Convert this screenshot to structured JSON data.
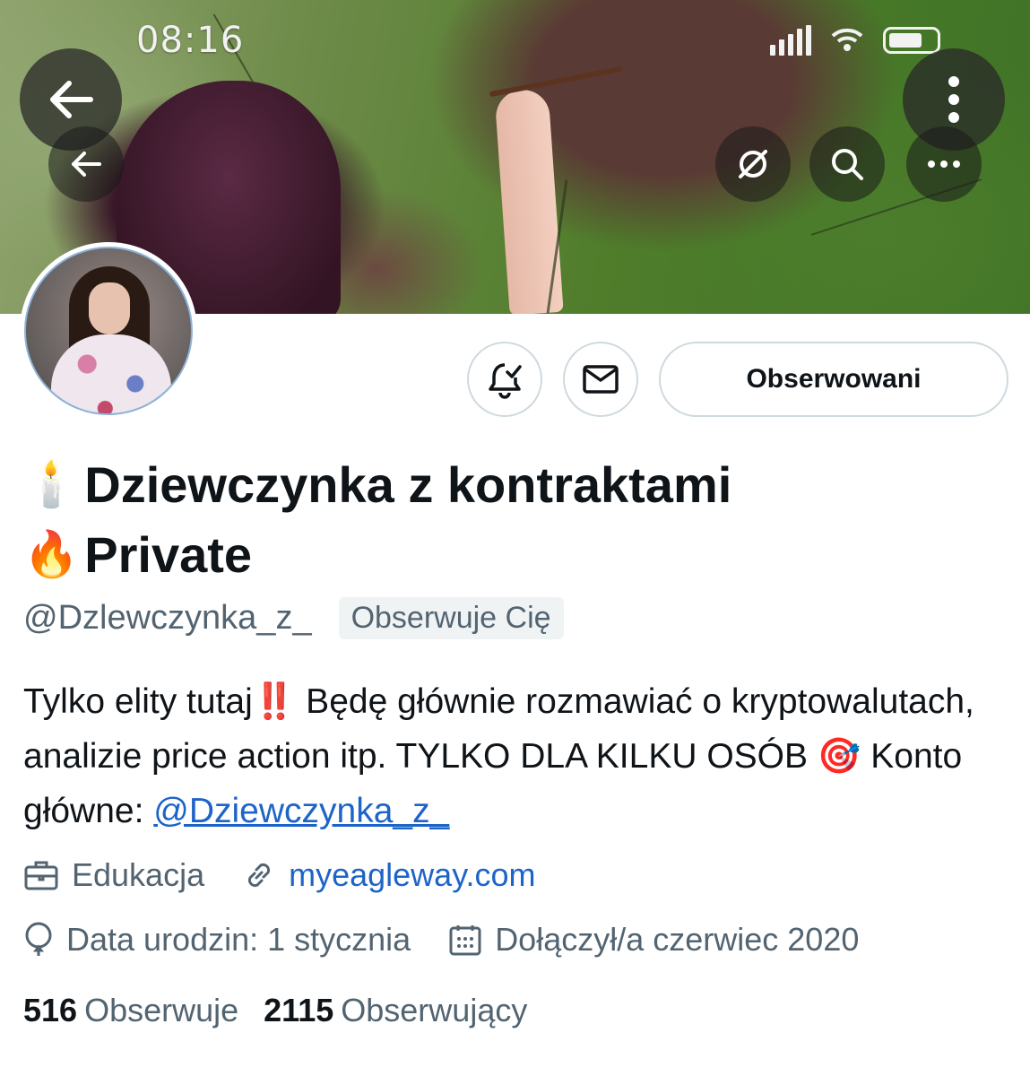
{
  "status_bar": {
    "time": "08:16"
  },
  "profile": {
    "name_line1": "Dziewczynka z kontraktami",
    "name_line1_emoji": "🕯️",
    "name_line2": "Private",
    "name_line2_emoji": "🔥",
    "handle": "@Dzlewczynka_z_",
    "follows_you_badge": "Obserwuje Cię",
    "follow_button": "Obserwowani",
    "bio": {
      "part1": "Tylko elity tutaj",
      "emoji1": "‼️",
      "part2": " Będę głównie rozmawiać o kryptowalutach, analizie price action itp. TYLKO DLA KILKU OSÓB ",
      "emoji2": "🎯",
      "part3": " Konto główne: ",
      "mention": "@Dziewczynka_z_"
    },
    "category": "Edukacja",
    "website": "myeagleway.com",
    "birthday": "Data urodzin: 1 stycznia",
    "joined": "Dołączył/a czerwiec 2020",
    "following_count": "516",
    "following_label": "Obserwuje",
    "followers_count": "2115",
    "followers_label": "Obserwujący"
  },
  "icons": {
    "back": "arrow-left-icon",
    "more_vertical": "more-vertical-icon",
    "no_translate": "globe-slash-icon",
    "search": "search-icon",
    "more_horizontal": "more-horizontal-icon",
    "bell": "bell-check-icon",
    "mail": "mail-icon",
    "briefcase": "briefcase-icon",
    "link": "link-icon",
    "balloon": "balloon-icon",
    "calendar": "calendar-icon"
  },
  "colors": {
    "link": "#1d64c8",
    "secondary_text": "#536471",
    "primary_text": "#0f1419",
    "button_border": "#cfd9de"
  }
}
